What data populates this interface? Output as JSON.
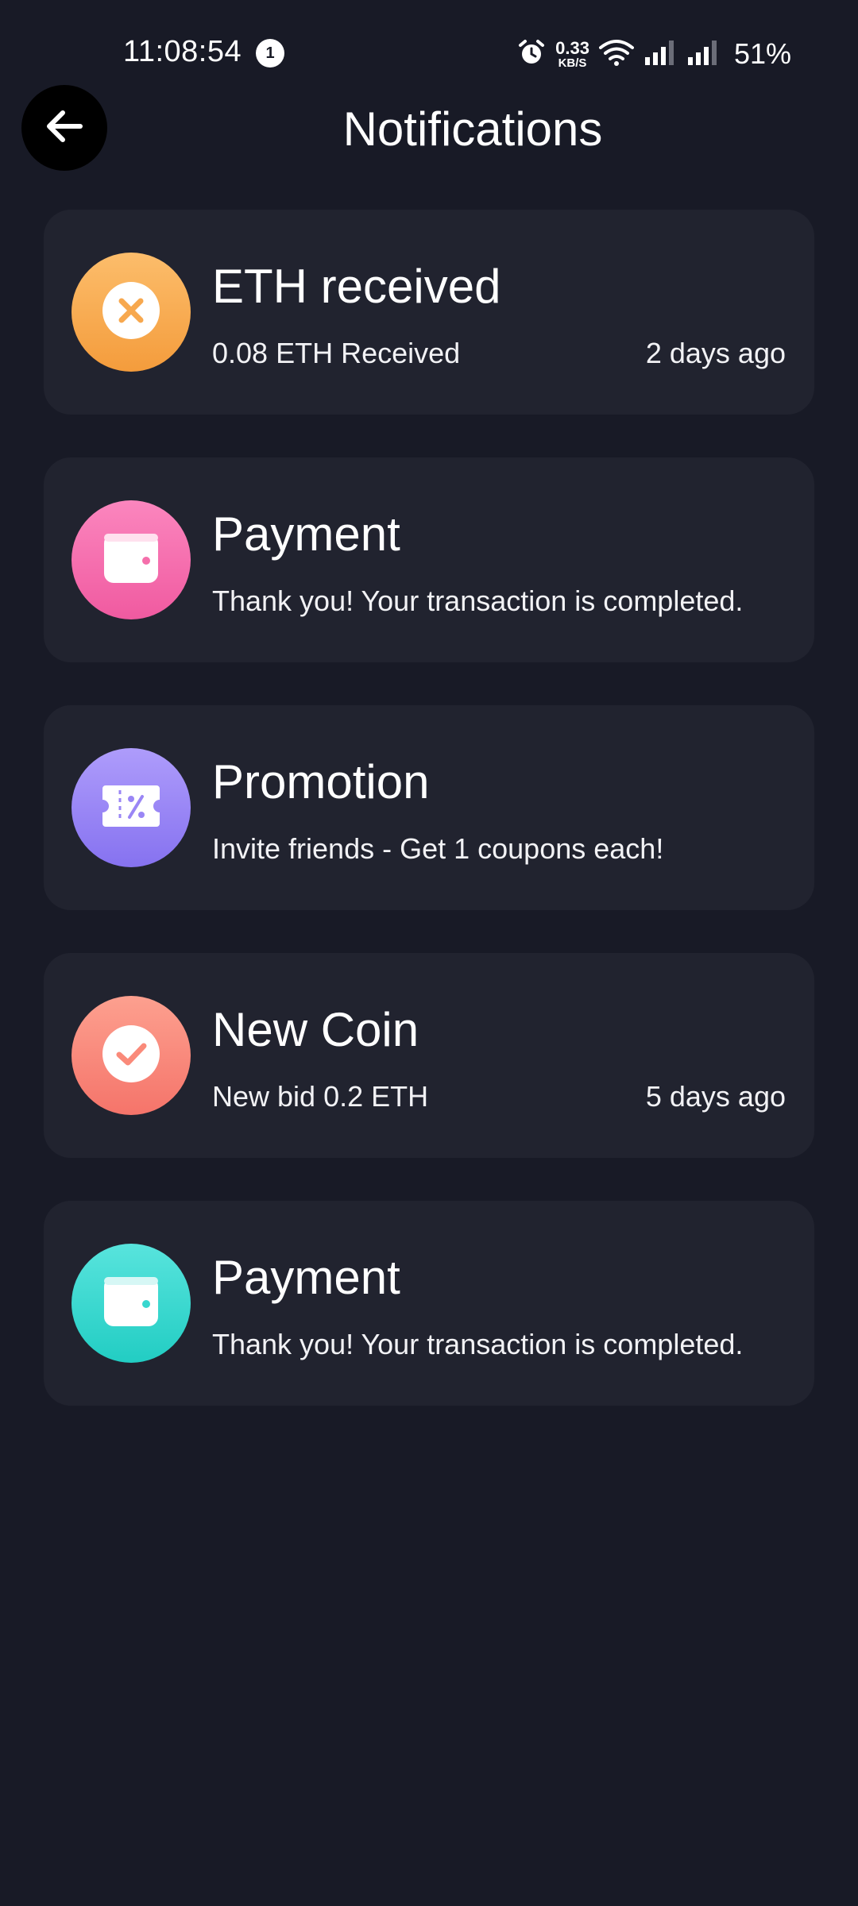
{
  "status_bar": {
    "time": "11:08:54",
    "notification_count": "1",
    "net_speed_value": "0.33",
    "net_speed_unit": "KB/S",
    "battery": "51%"
  },
  "header": {
    "title": "Notifications"
  },
  "colors": {
    "background": "#181a26",
    "card": "#21232f",
    "orange": "#f7a84e",
    "pink": "#f56fab",
    "purple": "#9a86f5",
    "salmon": "#fa8a7a",
    "teal": "#38d7cf"
  },
  "notifications": [
    {
      "title": "ETH received",
      "subtitle": "0.08 ETH Received",
      "time": "2 days ago",
      "icon": "close-circle-icon"
    },
    {
      "title": "Payment",
      "subtitle": "Thank you! Your transaction is completed.",
      "time": "",
      "icon": "wallet-icon"
    },
    {
      "title": "Promotion",
      "subtitle": "Invite friends - Get 1 coupons each!",
      "time": "",
      "icon": "coupon-icon"
    },
    {
      "title": "New Coin",
      "subtitle": "New bid 0.2 ETH",
      "time": "5 days ago",
      "icon": "check-circle-icon"
    },
    {
      "title": "Payment",
      "subtitle": "Thank you! Your transaction is completed.",
      "time": "",
      "icon": "wallet-icon"
    }
  ]
}
